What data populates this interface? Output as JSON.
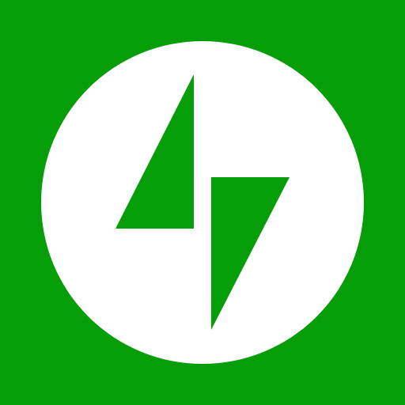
{
  "icon": {
    "name": "jetpack-logo-icon",
    "colors": {
      "background": "#069E08",
      "circle": "#FFFFFF",
      "bolt": "#069E08"
    }
  }
}
